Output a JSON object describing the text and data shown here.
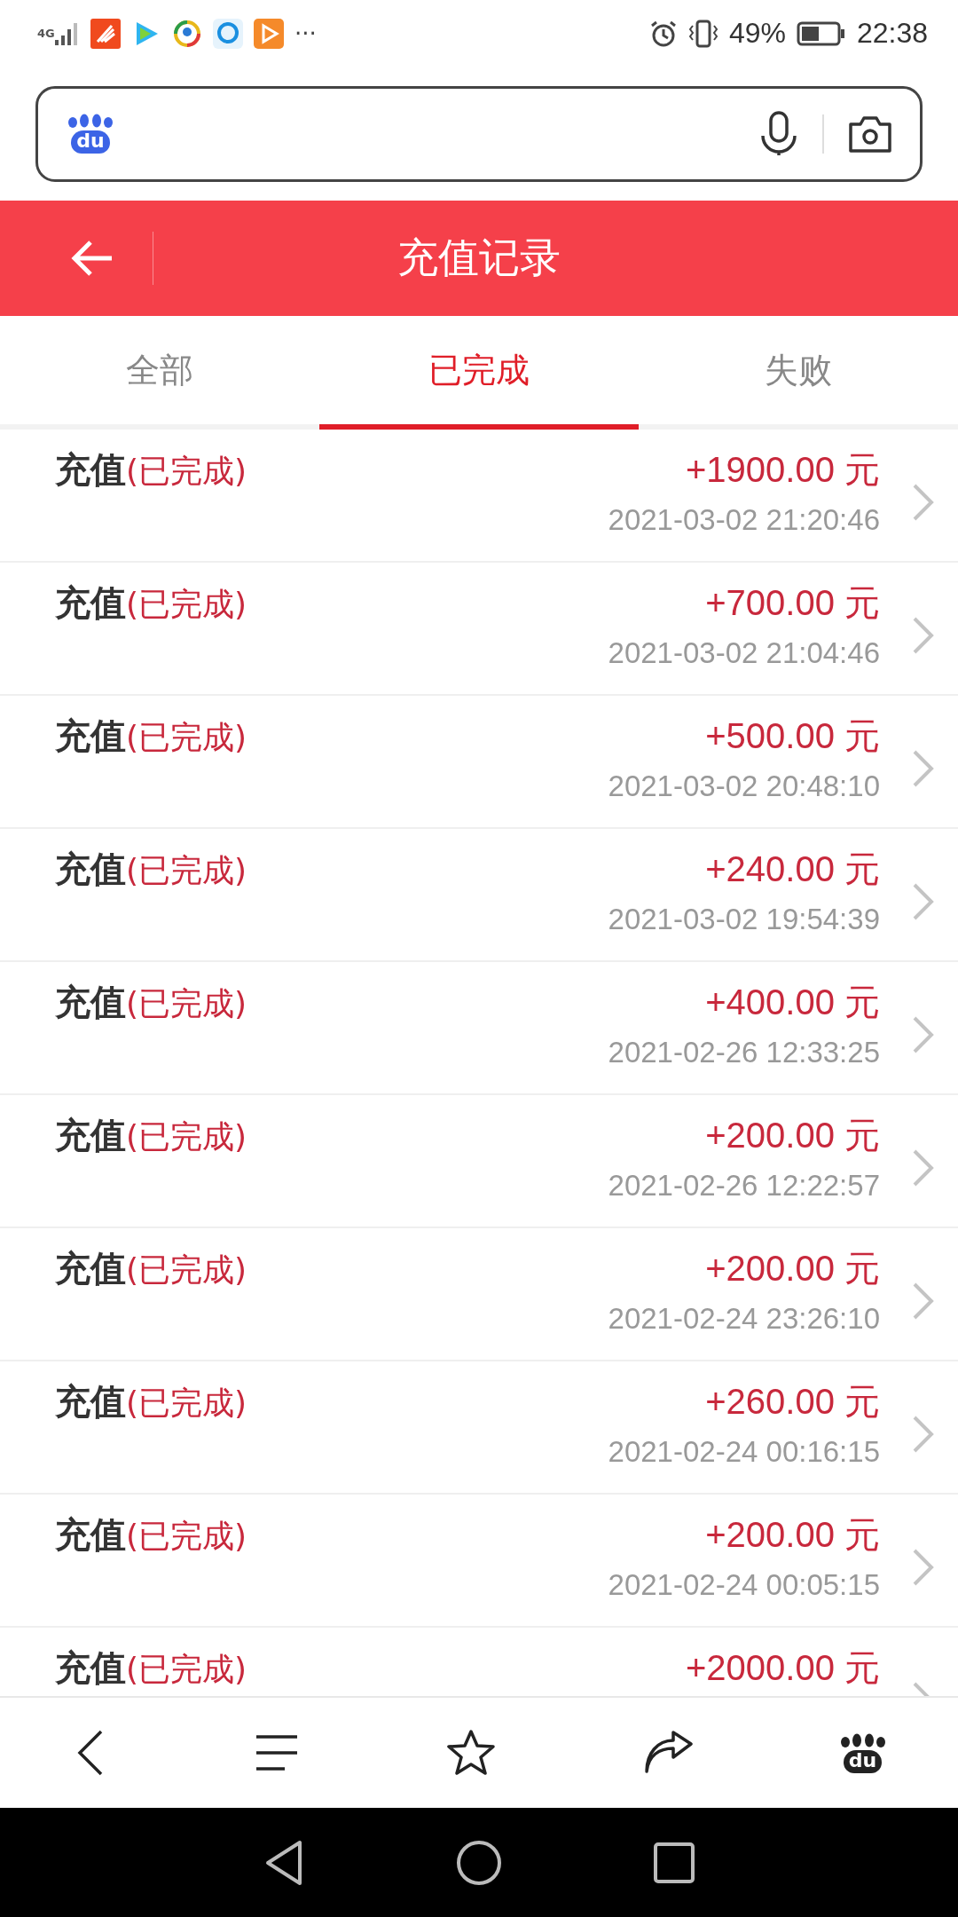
{
  "status_bar": {
    "network": "4G",
    "more": "···",
    "battery_percent": "49%",
    "time": "22:38"
  },
  "search": {
    "logo_text": "du"
  },
  "header": {
    "title": "充值记录"
  },
  "tabs": [
    {
      "label": "全部",
      "selected": false
    },
    {
      "label": "已完成",
      "selected": true
    },
    {
      "label": "失败",
      "selected": false
    }
  ],
  "records": [
    {
      "title": "充值",
      "status": "(已完成)",
      "amount": "+1900.00 元",
      "time": "2021-03-02 21:20:46"
    },
    {
      "title": "充值",
      "status": "(已完成)",
      "amount": "+700.00 元",
      "time": "2021-03-02 21:04:46"
    },
    {
      "title": "充值",
      "status": "(已完成)",
      "amount": "+500.00 元",
      "time": "2021-03-02 20:48:10"
    },
    {
      "title": "充值",
      "status": "(已完成)",
      "amount": "+240.00 元",
      "time": "2021-03-02 19:54:39"
    },
    {
      "title": "充值",
      "status": "(已完成)",
      "amount": "+400.00 元",
      "time": "2021-02-26 12:33:25"
    },
    {
      "title": "充值",
      "status": "(已完成)",
      "amount": "+200.00 元",
      "time": "2021-02-26 12:22:57"
    },
    {
      "title": "充值",
      "status": "(已完成)",
      "amount": "+200.00 元",
      "time": "2021-02-24 23:26:10"
    },
    {
      "title": "充值",
      "status": "(已完成)",
      "amount": "+260.00 元",
      "time": "2021-02-24 00:16:15"
    },
    {
      "title": "充值",
      "status": "(已完成)",
      "amount": "+200.00 元",
      "time": "2021-02-24 00:05:15"
    },
    {
      "title": "充值",
      "status": "(已完成)",
      "amount": "+2000.00 元"
    }
  ],
  "bottom_bar": {
    "logo_text": "du"
  }
}
